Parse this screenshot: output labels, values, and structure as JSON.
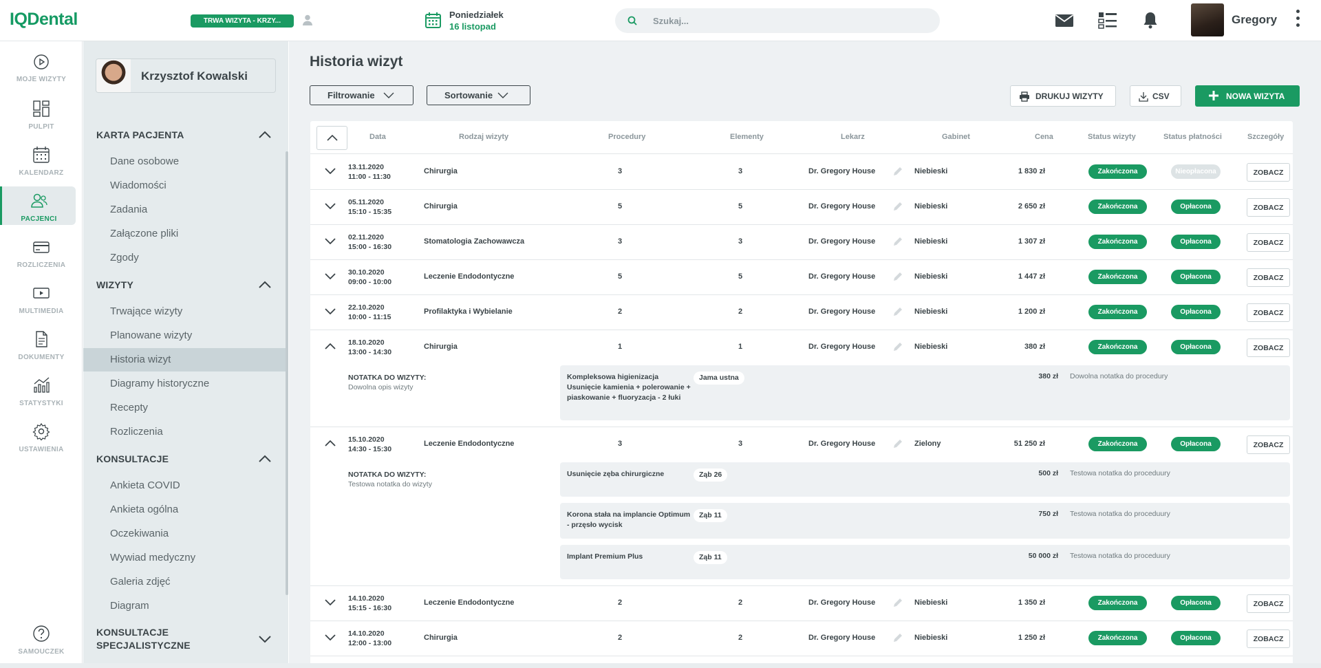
{
  "app": {
    "logo": "IQDental",
    "visit_status": "TRWA WIZYTA - KRZY...",
    "day": "Poniedziałek",
    "date": "16 listopad",
    "search_placeholder": "Szukaj...",
    "username": "Gregory"
  },
  "nav": [
    {
      "label": "MOJE WIZYTY",
      "icon": "play-circle-icon"
    },
    {
      "label": "PULPIT",
      "icon": "dashboard-icon"
    },
    {
      "label": "KALENDARZ",
      "icon": "calendar-icon"
    },
    {
      "label": "PACJENCI",
      "icon": "patients-icon",
      "active": true
    },
    {
      "label": "ROZLICZENIA",
      "icon": "credit-card-icon"
    },
    {
      "label": "MULTIMEDIA",
      "icon": "media-icon"
    },
    {
      "label": "DOKUMENTY",
      "icon": "document-icon"
    },
    {
      "label": "STATYSTYKI",
      "icon": "chart-icon"
    },
    {
      "label": "USTAWIENIA",
      "icon": "gear-icon"
    },
    {
      "label": "SAMOUCZEK",
      "icon": "help-icon"
    }
  ],
  "patient": {
    "name": "Krzysztof Kowalski"
  },
  "sections": [
    {
      "title": "KARTA PACJENTA",
      "items": [
        "Dane osobowe",
        "Wiadomości",
        "Zadania",
        "Załączone pliki",
        "Zgody"
      ]
    },
    {
      "title": "WIZYTY",
      "items": [
        "Trwające wizyty",
        "Planowane wizyty",
        "Historia wizyt",
        "Diagramy historyczne",
        "Recepty",
        "Rozliczenia"
      ]
    },
    {
      "title": "KONSULTACJE",
      "items": [
        "Ankieta COVID",
        "Ankieta ogólna",
        "Oczekiwania",
        "Wywiad medyczny",
        "Galeria zdjęć",
        "Diagram"
      ]
    },
    {
      "title_line1": "KONSULTACJE",
      "title_line2": "SPECJALISTYCZNE"
    }
  ],
  "main": {
    "title": "Historia wizyt",
    "filter": "Filtrowanie",
    "sort": "Sortowanie",
    "print": "DRUKUJ WIZYTY",
    "csv": "CSV",
    "new_visit": "NOWA WIZYTA"
  },
  "columns": [
    "Data",
    "Rodzaj wizyty",
    "Procedury",
    "Elementy",
    "Lekarz",
    "Gabinet",
    "Cena",
    "Status wizyty",
    "Status płatności",
    "Szczegóły"
  ],
  "rows": [
    {
      "date": "13.11.2020",
      "time": "11:00 - 11:30",
      "type": "Chirurgia",
      "procedures": "3",
      "elements": "3",
      "doctor": "Dr. Gregory House",
      "room": "Niebieski",
      "price": "1 830 zł",
      "status": "Zakończona",
      "payment": "Nieopłacona",
      "details": "ZOBACZ"
    },
    {
      "date": "05.11.2020",
      "time": "15:10 - 15:35",
      "type": "Chirurgia",
      "procedures": "5",
      "elements": "5",
      "doctor": "Dr. Gregory House",
      "room": "Niebieski",
      "price": "2 650 zł",
      "status": "Zakończona",
      "payment": "Opłacona",
      "details": "ZOBACZ"
    },
    {
      "date": "02.11.2020",
      "time": "15:00 - 16:30",
      "type": "Stomatologia Zachowawcza",
      "procedures": "3",
      "elements": "3",
      "doctor": "Dr. Gregory House",
      "room": "Niebieski",
      "price": "1 307 zł",
      "status": "Zakończona",
      "payment": "Opłacona",
      "details": "ZOBACZ"
    },
    {
      "date": "30.10.2020",
      "time": "09:00 - 10:00",
      "type": "Leczenie Endodontyczne",
      "procedures": "5",
      "elements": "5",
      "doctor": "Dr. Gregory House",
      "room": "Niebieski",
      "price": "1 447 zł",
      "status": "Zakończona",
      "payment": "Opłacona",
      "details": "ZOBACZ"
    },
    {
      "date": "22.10.2020",
      "time": "10:00 - 11:15",
      "type": "Profilaktyka i Wybielanie",
      "procedures": "2",
      "elements": "2",
      "doctor": "Dr. Gregory House",
      "room": "Niebieski",
      "price": "1 200 zł",
      "status": "Zakończona",
      "payment": "Opłacona",
      "details": "ZOBACZ"
    },
    {
      "date": "18.10.2020",
      "time": "13:00 - 14:30",
      "type": "Chirurgia",
      "procedures": "1",
      "elements": "1",
      "doctor": "Dr. Gregory House",
      "room": "Niebieski",
      "price": "380 zł",
      "status": "Zakończona",
      "payment": "Opłacona",
      "details": "ZOBACZ"
    },
    {
      "date": "15.10.2020",
      "time": "14:30 - 15:30",
      "type": "Leczenie Endodontyczne",
      "procedures": "3",
      "elements": "3",
      "doctor": "Dr. Gregory House",
      "room": "Zielony",
      "price": "51 250 zł",
      "status": "Zakończona",
      "payment": "Opłacona",
      "details": "ZOBACZ"
    },
    {
      "date": "14.10.2020",
      "time": "15:15 - 16:30",
      "type": "Leczenie Endodontyczne",
      "procedures": "2",
      "elements": "2",
      "doctor": "Dr. Gregory House",
      "room": "Niebieski",
      "price": "1 350 zł",
      "status": "Zakończona",
      "payment": "Opłacona",
      "details": "ZOBACZ"
    },
    {
      "date": "14.10.2020",
      "time": "12:00 - 13:00",
      "type": "Chirurgia",
      "procedures": "2",
      "elements": "2",
      "doctor": "Dr. Gregory House",
      "room": "Niebieski",
      "price": "1 250 zł",
      "status": "Zakończona",
      "payment": "Opłacona",
      "details": "ZOBACZ"
    }
  ],
  "expand1": {
    "note_label": "NOTATKA DO WIZYTY:",
    "note": "Dowolna opis wizyty",
    "procs": [
      {
        "name": "Kompleksowa higienizacja Usunięcie kamienia + polerowanie + piaskowanie + fluoryzacja - 2 łuki",
        "tag": "Jama ustna",
        "price": "380 zł",
        "note": "Dowolna notatka do procedury"
      }
    ]
  },
  "expand2": {
    "note_label": "NOTATKA DO WIZYTY:",
    "note": "Testowa notatka do wizyty",
    "procs": [
      {
        "name": "Usunięcie zęba chirurgiczne",
        "tag": "Ząb 26",
        "price": "500 zł",
        "note": "Testowa notatka do proceduury"
      },
      {
        "name": "Korona stała na implancie Optimum - przęsło wycisk",
        "tag": "Ząb 11",
        "price": "750 zł",
        "note": "Testowa notatka do proceduury"
      },
      {
        "name": "Implant Premium Plus",
        "tag": "Ząb 11",
        "price": "50 000 zł",
        "note": "Testowa notatka do proceduury"
      }
    ]
  },
  "colors": {
    "accent": "#1a9a62",
    "panel": "#e5ebed",
    "main_bg": "#eef1f3"
  }
}
